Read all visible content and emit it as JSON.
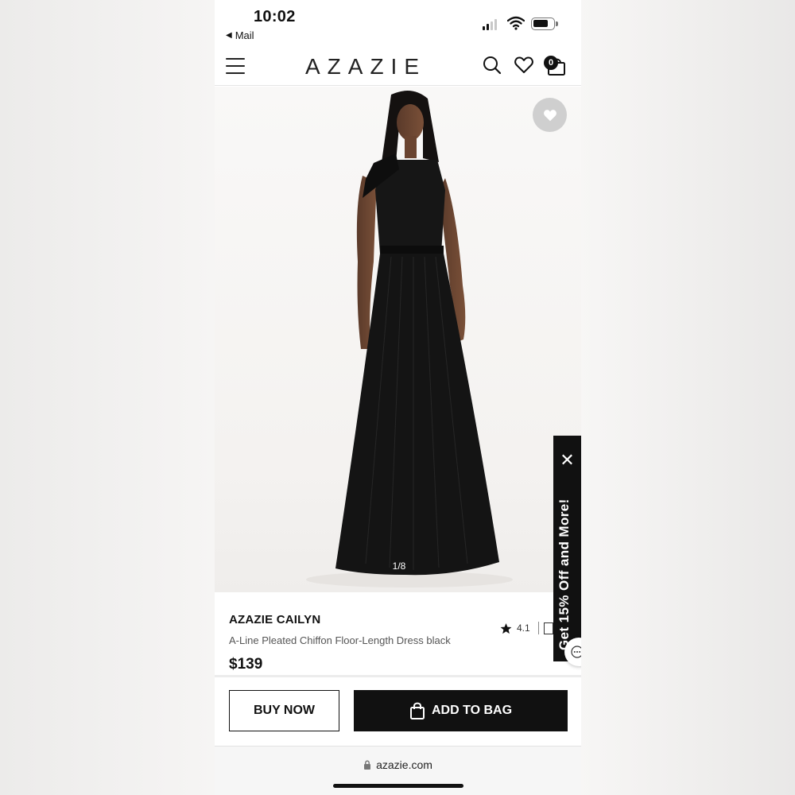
{
  "status_bar": {
    "time": "10:02",
    "back_label": "Mail"
  },
  "header": {
    "logo": "AZAZIE",
    "bag_count": "0"
  },
  "gallery": {
    "image_counter": "1/8"
  },
  "product": {
    "brand_name": "AZAZIE CAILYN",
    "description": "A-Line Pleated Chiffon Floor-Length Dress black",
    "price": "$139",
    "rating": "4.1"
  },
  "promo": {
    "text": "Get 15% Off and More!",
    "close_glyph": "✕"
  },
  "actions": {
    "buy_now": "BUY NOW",
    "add_to_bag": "ADD TO BAG"
  },
  "browser": {
    "url": "azazie.com"
  },
  "colors": {
    "primary": "#111111",
    "background": "#ffffff",
    "promo_bg": "#111111"
  }
}
